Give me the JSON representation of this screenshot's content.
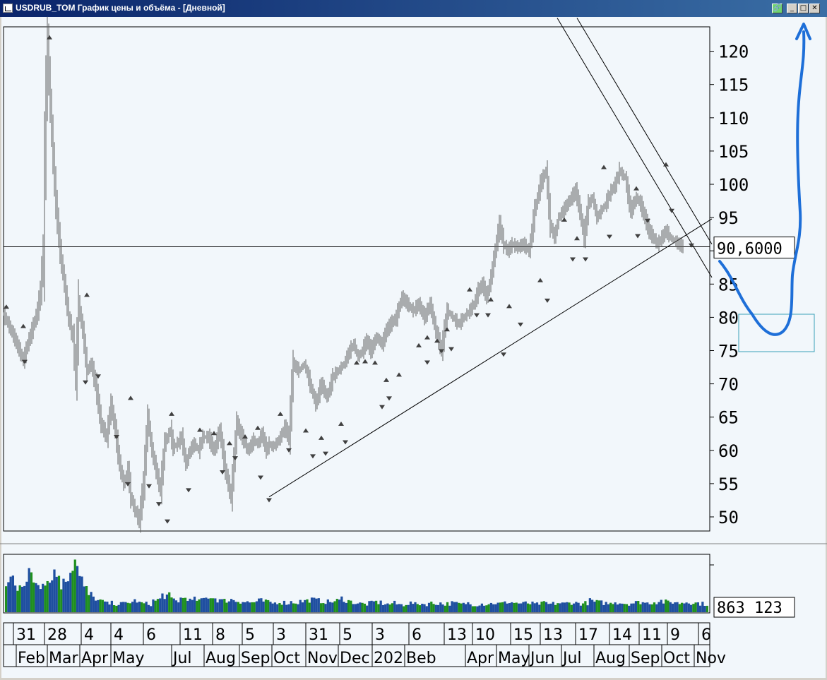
{
  "window": {
    "title": "USDRUB_TOM График цены и объёма - [Дневной]",
    "buttons": {
      "link": "🔗",
      "minimize": "_",
      "maximize": "□",
      "close": "✕"
    }
  },
  "colors": {
    "background": "#f2f7fb",
    "price": "#606060",
    "volume_blue": "#1f4fa0",
    "volume_green": "#1f8f1f",
    "annotation": "#1e6fd8",
    "box": "#3aa0b8"
  },
  "chart_data": [
    {
      "type": "line",
      "name": "price",
      "ylim": [
        47,
        125
      ],
      "yticks": [
        120,
        115,
        110,
        105,
        100,
        95,
        90,
        85,
        80,
        75,
        70,
        65,
        60,
        55,
        50
      ],
      "last_value_label": "90,6000",
      "x": [
        0,
        15,
        28,
        34,
        40,
        48,
        52,
        56,
        59,
        62,
        66,
        70,
        74,
        80,
        86,
        92,
        98,
        102,
        106,
        112,
        118,
        124,
        130,
        138,
        146,
        152,
        158,
        164,
        170,
        176,
        180,
        186,
        192,
        198,
        204,
        210,
        216,
        222,
        228,
        232,
        236,
        240,
        246,
        252,
        258,
        264,
        270,
        276,
        282,
        290,
        298,
        306,
        314,
        322,
        330,
        338,
        346,
        354,
        360,
        366,
        372,
        376,
        380,
        386,
        392,
        398,
        404,
        410,
        418,
        426,
        434,
        442,
        450,
        458,
        466,
        474,
        482,
        490,
        496,
        502,
        508,
        514,
        520,
        528,
        536,
        542,
        548,
        556,
        564,
        572,
        580,
        588,
        596,
        604,
        612,
        620,
        628,
        636,
        644,
        652,
        660,
        666,
        672,
        678,
        684,
        690,
        696,
        702,
        708,
        714,
        720,
        728,
        736,
        744,
        752,
        760,
        768,
        774,
        780,
        786,
        792,
        798,
        804,
        810,
        816,
        822,
        828,
        834,
        840,
        846,
        852,
        856,
        860,
        866,
        872,
        880,
        888,
        896,
        902,
        908,
        914,
        920,
        926,
        932,
        938,
        944,
        950,
        956,
        962,
        968,
        974,
        980,
        986,
        992,
        998
      ],
      "y": [
        80.5,
        77,
        73.5,
        76,
        78,
        81,
        84,
        90,
        110,
        121,
        112,
        104,
        97,
        90,
        85,
        80,
        77,
        71,
        82,
        78,
        72,
        73,
        70,
        64,
        62,
        67,
        63,
        58,
        55,
        57,
        53,
        51,
        49.5,
        55,
        65,
        60,
        57,
        54,
        61,
        62,
        63,
        60.5,
        61,
        62,
        58,
        60,
        61,
        60,
        62,
        62,
        60,
        63,
        57,
        53,
        64,
        62,
        60,
        61.5,
        61,
        62.5,
        60,
        61,
        60.5,
        61,
        62,
        63.5,
        62,
        73,
        72,
        73,
        70,
        67,
        70,
        68,
        71,
        72,
        73,
        75,
        76,
        74,
        75,
        76.5,
        75,
        77,
        76,
        78,
        79,
        80,
        83,
        82,
        81,
        82,
        80,
        82,
        78,
        75,
        81,
        80,
        79,
        80,
        81,
        82,
        84,
        85,
        83,
        86,
        90,
        94,
        91,
        90,
        91,
        90.5,
        91,
        90,
        96,
        100,
        102,
        94,
        92,
        95,
        96,
        97,
        98,
        99,
        96,
        92,
        97,
        98,
        95,
        96,
        97,
        98,
        99,
        100,
        102,
        101,
        96,
        98,
        97,
        95,
        93,
        92,
        91,
        92,
        93,
        92,
        91.5,
        91,
        90.6
      ],
      "peaks": [
        [
          4,
          81.5
        ],
        [
          28,
          78.6
        ],
        [
          65,
          122
        ],
        [
          118,
          83.3
        ],
        [
          180,
          67.8
        ],
        [
          238,
          65.4
        ],
        [
          278,
          63
        ],
        [
          298,
          62.5
        ],
        [
          320,
          61
        ],
        [
          342,
          62
        ],
        [
          360,
          63.3
        ],
        [
          392,
          65.4
        ],
        [
          428,
          62.9
        ],
        [
          450,
          61.8
        ],
        [
          478,
          63.9
        ],
        [
          500,
          73.1
        ],
        [
          512,
          73.3
        ],
        [
          526,
          73.1
        ],
        [
          542,
          70.5
        ],
        [
          560,
          71.3
        ],
        [
          588,
          75.7
        ],
        [
          600,
          76.9
        ],
        [
          614,
          76.4
        ],
        [
          628,
          78.1
        ],
        [
          660,
          84.1
        ],
        [
          690,
          82.6
        ],
        [
          716,
          81.6
        ],
        [
          760,
          85.5
        ],
        [
          794,
          94.6
        ],
        [
          812,
          91.8
        ],
        [
          850,
          102.5
        ],
        [
          896,
          99.3
        ],
        [
          938,
          102.9
        ]
      ],
      "troughs": [
        [
          30,
          73.4
        ],
        [
          116,
          70.3
        ],
        [
          134,
          71.2
        ],
        [
          160,
          62.1
        ],
        [
          176,
          55
        ],
        [
          206,
          54.7
        ],
        [
          220,
          52
        ],
        [
          232,
          49.4
        ],
        [
          262,
          54.1
        ],
        [
          310,
          56.8
        ],
        [
          328,
          58.9
        ],
        [
          364,
          56
        ],
        [
          376,
          52.6
        ],
        [
          404,
          60.1
        ],
        [
          438,
          59.2
        ],
        [
          456,
          59.6
        ],
        [
          484,
          61.3
        ],
        [
          536,
          66.6
        ],
        [
          546,
          67.9
        ],
        [
          600,
          73.3
        ],
        [
          620,
          75
        ],
        [
          634,
          75.3
        ],
        [
          670,
          80.4
        ],
        [
          686,
          80.4
        ],
        [
          708,
          74.5
        ],
        [
          732,
          79
        ],
        [
          770,
          82.6
        ],
        [
          806,
          88.8
        ],
        [
          824,
          88.8
        ],
        [
          858,
          92.2
        ],
        [
          898,
          92.3
        ],
        [
          912,
          94.6
        ],
        [
          946,
          96.1
        ],
        [
          974,
          90.9
        ]
      ],
      "trendlines": [
        [
          [
            376,
            53
          ],
          [
            1003,
            94.8
          ]
        ],
        [
          [
            784,
            125
          ],
          [
            1003,
            86
          ]
        ],
        [
          [
            812,
            125
          ],
          [
            1003,
            91
          ]
        ]
      ],
      "hline": 90.6
    },
    {
      "type": "bar",
      "name": "volume",
      "last_value_label": "863 123",
      "values": [
        0.5,
        0.6,
        0.45,
        0.55,
        0.5,
        0.65,
        0.55,
        0.5,
        0.6,
        0.55,
        0.7,
        0.65,
        0.5,
        0.6,
        0.85,
        0.95,
        0.6,
        0.4,
        0.3,
        0.25,
        0.2,
        0.18,
        0.15,
        0.16,
        0.14,
        0.15,
        0.16,
        0.18,
        0.2,
        0.16,
        0.15,
        0.14,
        0.2,
        0.22,
        0.3,
        0.28,
        0.22,
        0.2,
        0.24,
        0.26,
        0.2,
        0.22,
        0.2,
        0.24,
        0.28,
        0.25,
        0.22,
        0.2,
        0.21,
        0.22,
        0.2,
        0.19,
        0.18,
        0.17,
        0.18,
        0.2,
        0.19,
        0.17,
        0.16,
        0.18,
        0.17,
        0.16,
        0.18,
        0.17,
        0.19,
        0.2,
        0.22,
        0.21,
        0.2,
        0.19,
        0.18,
        0.19,
        0.2,
        0.24,
        0.2,
        0.18,
        0.16,
        0.15,
        0.14,
        0.16,
        0.18,
        0.17,
        0.15,
        0.14,
        0.16,
        0.14,
        0.13,
        0.15,
        0.16,
        0.14,
        0.15,
        0.14,
        0.16,
        0.15,
        0.16,
        0.14,
        0.15,
        0.16,
        0.15,
        0.14,
        0.16,
        0.14,
        0.13,
        0.15,
        0.14,
        0.15,
        0.16,
        0.15,
        0.16,
        0.18,
        0.17,
        0.16,
        0.15,
        0.16,
        0.15,
        0.14,
        0.15,
        0.16,
        0.14,
        0.15,
        0.16,
        0.15,
        0.16,
        0.17,
        0.16,
        0.15,
        0.16,
        0.2,
        0.18,
        0.17,
        0.16,
        0.15,
        0.18,
        0.17,
        0.16,
        0.15,
        0.16,
        0.17,
        0.18,
        0.16,
        0.17,
        0.18,
        0.2,
        0.18,
        0.17,
        0.18,
        0.16,
        0.17,
        0.18,
        0.17,
        0.16,
        0.15,
        0.14
      ]
    }
  ],
  "xaxis": {
    "days": [
      {
        "t": "31",
        "x": 14
      },
      {
        "t": "28",
        "x": 58
      },
      {
        "t": "4",
        "x": 110
      },
      {
        "t": "4",
        "x": 152
      },
      {
        "t": "6",
        "x": 198
      },
      {
        "t": "11",
        "x": 250
      },
      {
        "t": "8",
        "x": 296
      },
      {
        "t": "5",
        "x": 338
      },
      {
        "t": "3",
        "x": 382
      },
      {
        "t": "31",
        "x": 428
      },
      {
        "t": "5",
        "x": 476
      },
      {
        "t": "3",
        "x": 522
      },
      {
        "t": "6",
        "x": 574
      },
      {
        "t": "13",
        "x": 624
      },
      {
        "t": "10",
        "x": 664
      },
      {
        "t": "15",
        "x": 718
      },
      {
        "t": "13",
        "x": 760
      },
      {
        "t": "17",
        "x": 810
      },
      {
        "t": "14",
        "x": 858
      },
      {
        "t": "11",
        "x": 900
      },
      {
        "t": "9",
        "x": 940
      },
      {
        "t": "6",
        "x": 984
      }
    ],
    "months": [
      {
        "t": "Feb",
        "x": 18
      },
      {
        "t": "Mar",
        "x": 62
      },
      {
        "t": "Apr",
        "x": 108
      },
      {
        "t": "May",
        "x": 152
      },
      {
        "t": "Jul",
        "x": 238
      },
      {
        "t": "Aug",
        "x": 284
      },
      {
        "t": "Sep",
        "x": 334
      },
      {
        "t": "Oct",
        "x": 380
      },
      {
        "t": "Nov",
        "x": 428
      },
      {
        "t": "Dec",
        "x": 474
      },
      {
        "t": "202",
        "x": 522
      },
      {
        "t": "Beb",
        "x": 568
      },
      {
        "t": "Apr",
        "x": 654
      },
      {
        "t": "May",
        "x": 698
      },
      {
        "t": "Jun",
        "x": 744
      },
      {
        "t": "Jul",
        "x": 790
      },
      {
        "t": "Aug",
        "x": 836
      },
      {
        "t": "Sep",
        "x": 886
      },
      {
        "t": "Oct",
        "x": 932
      },
      {
        "t": "Nov",
        "x": 978
      }
    ]
  }
}
